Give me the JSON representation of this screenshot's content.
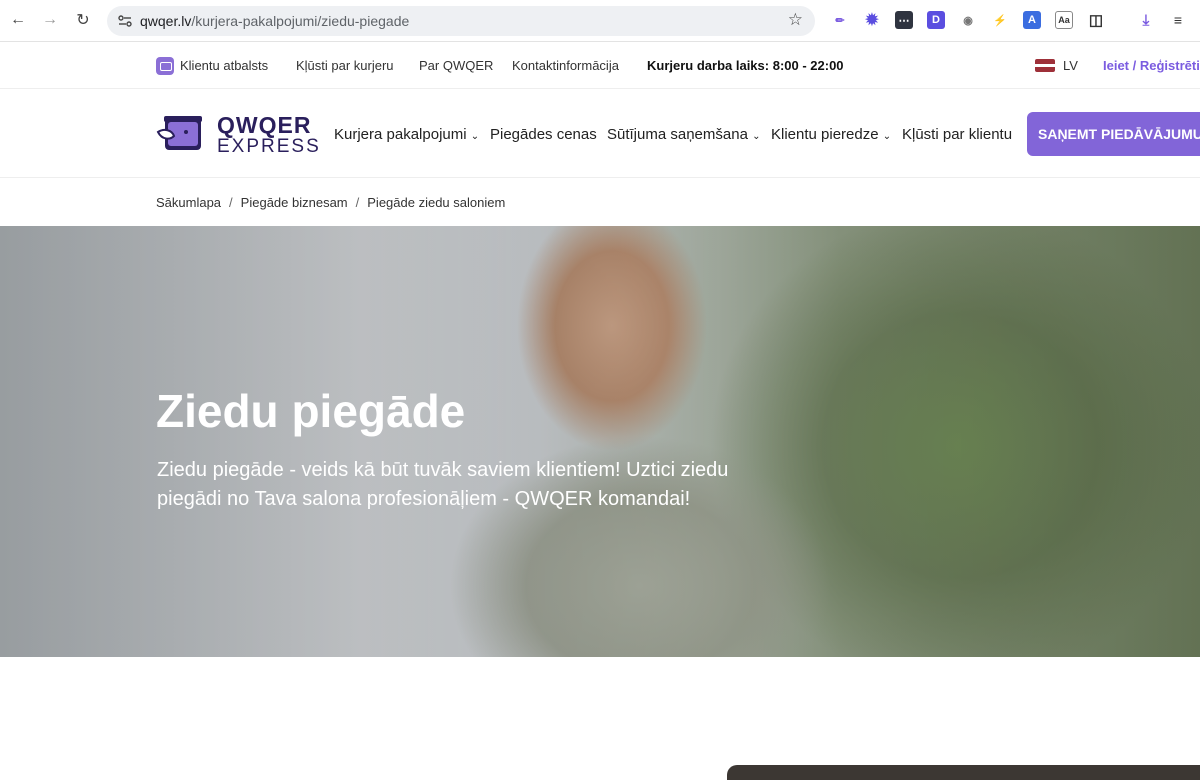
{
  "browser": {
    "url_domain": "qwqer.lv",
    "url_path": "/kurjera-pakalpojumi/ziedu-piegade"
  },
  "topbar": {
    "support": "Klientu atbalsts",
    "become_courier": "Kļūsti par kurjeru",
    "about": "Par QWQER",
    "contacts": "Kontaktinformācija",
    "hours": "Kurjeru darba laiks: 8:00 - 22:00",
    "lang": "LV",
    "login": "Ieiet / Reģistrēties"
  },
  "logo": {
    "line1": "QWQER",
    "line2": "EXPRESS"
  },
  "nav": {
    "items": [
      {
        "label": "Kurjera pakalpojumi",
        "dropdown": true
      },
      {
        "label": "Piegādes cenas",
        "dropdown": false
      },
      {
        "label": "Sūtījuma saņemšana",
        "dropdown": true
      },
      {
        "label": "Klientu pieredze",
        "dropdown": true
      },
      {
        "label": "Kļūsti par klientu",
        "dropdown": false
      }
    ],
    "cta": "SAŅEMT PIEDĀVĀJUMU"
  },
  "breadcrumb": [
    "Sākumlapa",
    "Piegāde biznesam",
    "Piegāde ziedu saloniem"
  ],
  "hero": {
    "title": "Ziedu piegāde",
    "subtitle": "Ziedu piegāde - veids kā būt tuvāk saviem klientiem! Uztici ziedu piegādi no Tava salona profesionāļiem - QWQER komandai!"
  },
  "colors": {
    "accent": "#8265d8",
    "logo": "#2a1f5c"
  }
}
